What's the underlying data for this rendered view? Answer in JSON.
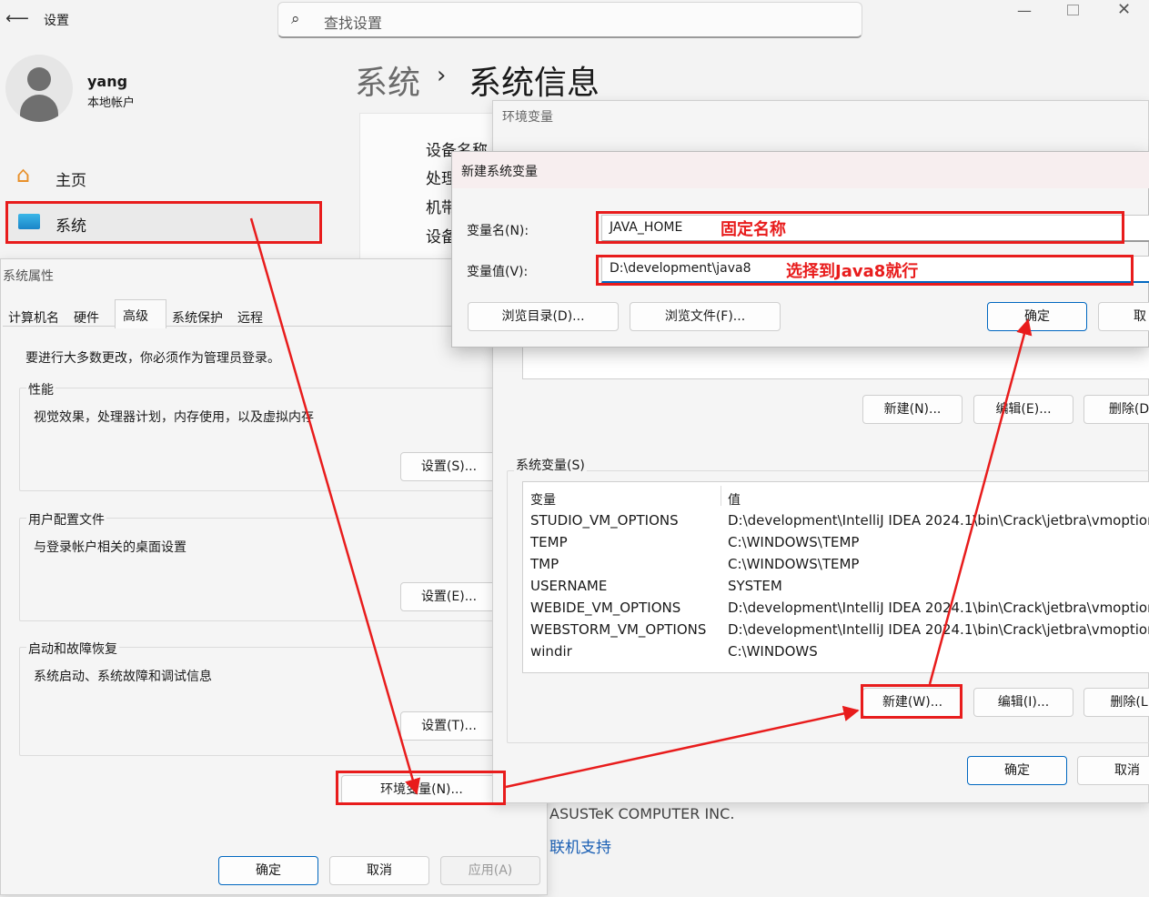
{
  "settings": {
    "back_icon": "arrow-left-icon",
    "title": "设置",
    "search_placeholder": "查找设置",
    "user_name": "yang",
    "user_type": "本地帐户",
    "nav_home": "主页",
    "nav_system": "系统",
    "breadcrumb_parent": "系统",
    "breadcrumb_sep": "›",
    "breadcrumb_current": "系统信息",
    "specs_row1": "设备名称",
    "specs_row2": "处理",
    "specs_row3": "机带",
    "specs_row4": "设备",
    "manufacturer": "ASUSTeK COMPUTER INC.",
    "support_link": "联机支持"
  },
  "sysprops": {
    "title": "系统属性",
    "tabs": [
      "计算机名",
      "硬件",
      "高级",
      "系统保护",
      "远程"
    ],
    "admin_note": "要进行大多数更改，你必须作为管理员登录。",
    "perf_title": "性能",
    "perf_desc": "视觉效果，处理器计划，内存使用，以及虚拟内存",
    "perf_btn": "设置(S)...",
    "profile_title": "用户配置文件",
    "profile_desc": "与登录帐户相关的桌面设置",
    "profile_btn": "设置(E)...",
    "startup_title": "启动和故障恢复",
    "startup_desc": "系统启动、系统故障和调试信息",
    "startup_btn": "设置(T)...",
    "env_btn": "环境变量(N)...",
    "ok": "确定",
    "cancel": "取消",
    "apply": "应用(A)"
  },
  "envvars": {
    "title": "环境变量",
    "user_new": "新建(N)...",
    "user_edit": "编辑(E)...",
    "user_delete": "删除(D",
    "sys_label": "系统变量(S)",
    "col_var": "变量",
    "col_val": "值",
    "rows": [
      {
        "name": "STUDIO_VM_OPTIONS",
        "value": "D:\\development\\IntelliJ IDEA 2024.1\\bin\\Crack\\jetbra\\vmoption"
      },
      {
        "name": "TEMP",
        "value": "C:\\WINDOWS\\TEMP"
      },
      {
        "name": "TMP",
        "value": "C:\\WINDOWS\\TEMP"
      },
      {
        "name": "USERNAME",
        "value": "SYSTEM"
      },
      {
        "name": "WEBIDE_VM_OPTIONS",
        "value": "D:\\development\\IntelliJ IDEA 2024.1\\bin\\Crack\\jetbra\\vmoption"
      },
      {
        "name": "WEBSTORM_VM_OPTIONS",
        "value": "D:\\development\\IntelliJ IDEA 2024.1\\bin\\Crack\\jetbra\\vmoption"
      },
      {
        "name": "windir",
        "value": "C:\\WINDOWS"
      }
    ],
    "sys_new": "新建(W)...",
    "sys_edit": "编辑(I)...",
    "sys_delete": "删除(L",
    "ok": "确定",
    "cancel": "取消"
  },
  "newvar": {
    "title": "新建系统变量",
    "name_label": "变量名(N):",
    "name_value": "JAVA_HOME",
    "value_label": "变量值(V):",
    "value_value": "D:\\development\\java8",
    "browse_dir": "浏览目录(D)...",
    "browse_file": "浏览文件(F)...",
    "ok": "确定",
    "cancel": "取"
  },
  "annotations": {
    "name_note": "固定名称",
    "value_note": "选择到Java8就行",
    "color": "#e81c1c"
  }
}
